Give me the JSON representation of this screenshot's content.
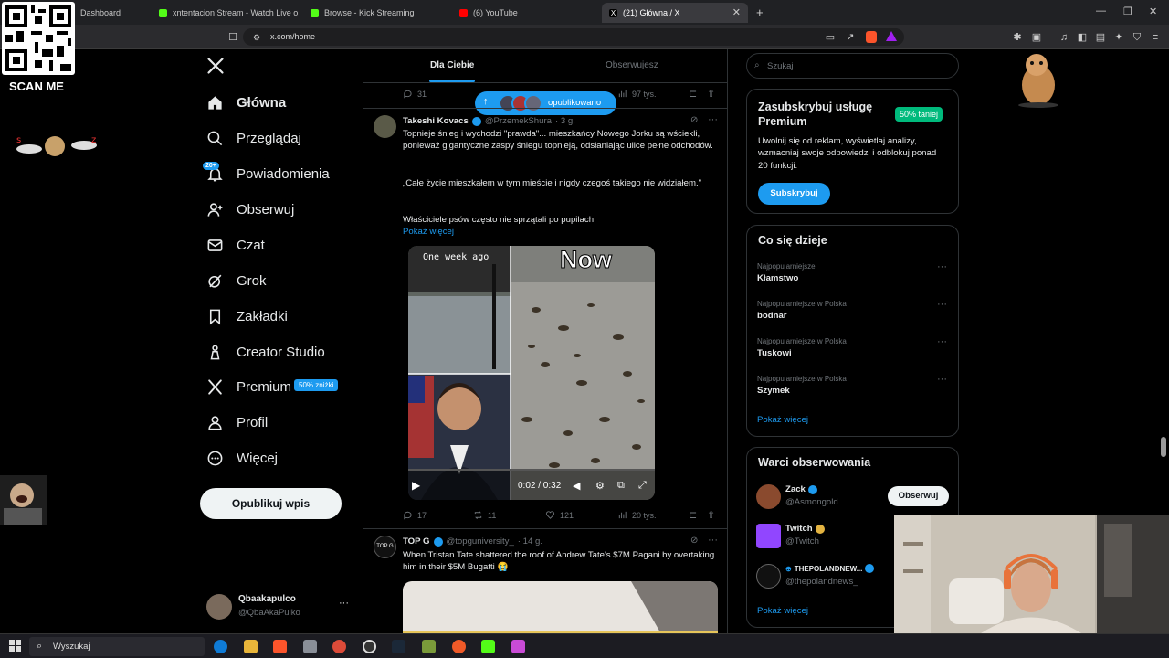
{
  "browser": {
    "tabs": [
      {
        "label": "Dashboard",
        "active": false
      },
      {
        "label": "xntentacion Stream - Watch Live on K",
        "active": false
      },
      {
        "label": "Browse - Kick Streaming",
        "active": false
      },
      {
        "label": "(6) YouTube",
        "active": false
      },
      {
        "label": "(21) Główna / X",
        "active": true
      }
    ],
    "new_tab": "+",
    "url": "x.com/home"
  },
  "overlay": {
    "qr_label": "SCAN ME"
  },
  "sidebar": {
    "items": [
      {
        "label": "Główna",
        "icon": "home-icon",
        "bold": true
      },
      {
        "label": "Przeglądaj",
        "icon": "search-icon"
      },
      {
        "label": "Powiadomienia",
        "icon": "bell-icon",
        "badge": "20+"
      },
      {
        "label": "Obserwuj",
        "icon": "person-add-icon"
      },
      {
        "label": "Czat",
        "icon": "mail-icon"
      },
      {
        "label": "Grok",
        "icon": "grok-icon"
      },
      {
        "label": "Zakładki",
        "icon": "bookmark-icon"
      },
      {
        "label": "Creator Studio",
        "icon": "creator-studio-icon"
      },
      {
        "label": "Premium",
        "icon": "x-premium-icon",
        "pill": "50% zniżki"
      },
      {
        "label": "Profil",
        "icon": "person-icon"
      },
      {
        "label": "Więcej",
        "icon": "more-circle-icon"
      }
    ],
    "post_button": "Opublikuj wpis",
    "account": {
      "name": "Qbaakapulco",
      "handle": "@QbaAkaPulko"
    }
  },
  "feed": {
    "tabs": [
      "Dla Ciebie",
      "Obserwujesz"
    ],
    "toast": "opublikowano",
    "prev_actions": {
      "replies": "31",
      "views": "97 tys."
    },
    "tweet1": {
      "name": "Takeshi Kovacs",
      "handle": "@PrzemekShura",
      "time": "· 3 g.",
      "p1": "Topnieje śnieg i wychodzi \"prawda\"... mieszkańcy Nowego Jorku są wściekli, ponieważ gigantyczne zaspy śniegu topnieją, odsłaniając ulice pełne odchodów.",
      "p2": "„Całe życie mieszkałem w tym mieście i nigdy czegoś takiego nie widziałem.\"",
      "p3": "Właściciele psów często nie sprzątali po pupilach",
      "show_more": "Pokaż więcej",
      "video_label_left": "One week ago",
      "video_label_right": "Now",
      "video_time": "0:02 / 0:32",
      "replies": "17",
      "reposts": "11",
      "likes": "121",
      "views": "20 tys."
    },
    "tweet2": {
      "name": "TOP G",
      "handle": "@topguniversity_",
      "time": "· 14 g.",
      "avatar_text": "TOP G",
      "text": "When Tristan Tate shattered the roof of Andrew Tate's $7M Pagani by overtaking him in their $5M Bugatti 😭"
    }
  },
  "right": {
    "search_placeholder": "Szukaj",
    "premium": {
      "title": "Zasubskrybuj usługę Premium",
      "badge": "50% taniej",
      "desc": "Uwolnij się od reklam, wyświetlaj analizy, wzmacniaj swoje odpowiedzi i odblokuj ponad 20 funkcji.",
      "button": "Subskrybuj"
    },
    "trends": {
      "title": "Co się dzieje",
      "items": [
        {
          "cat": "Najpopularniejsze",
          "name": "Kłamstwo"
        },
        {
          "cat": "Najpopularniejsze w Polska",
          "name": "bodnar"
        },
        {
          "cat": "Najpopularniejsze w Polska",
          "name": "Tuskowi"
        },
        {
          "cat": "Najpopularniejsze w Polska",
          "name": "Szymek"
        }
      ],
      "show_more": "Pokaż więcej"
    },
    "follow": {
      "title": "Warci obserwowania",
      "items": [
        {
          "name": "Zack",
          "handle": "@Asmongold",
          "button": "Obserwuj"
        },
        {
          "name": "Twitch",
          "handle": "@Twitch"
        },
        {
          "name": "THEPOLANDNEW...",
          "handle": "@thepolandnews_"
        }
      ],
      "show_more": "Pokaż więcej"
    }
  },
  "taskbar": {
    "search": "Wyszukaj"
  },
  "colors": {
    "accent": "#1d9bf0",
    "premium_badge_bg": "#00ba7c",
    "background": "#000000"
  }
}
